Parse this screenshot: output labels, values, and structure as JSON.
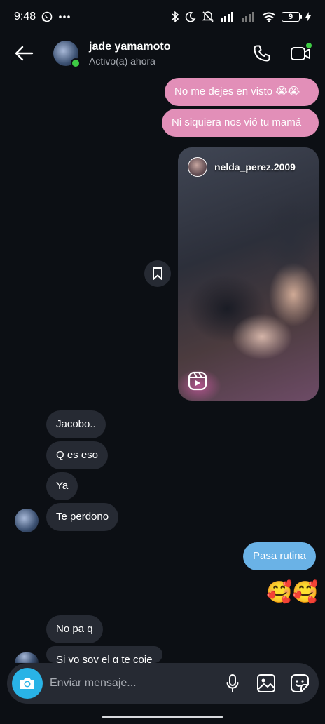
{
  "status_bar": {
    "time": "9:48",
    "battery": "9"
  },
  "header": {
    "name": "jade yamamoto",
    "status": "Activo(a) ahora"
  },
  "messages": {
    "out1": "No me dejes en visto 😭😭",
    "out2": "Ni siquiera nos vió tu mamá",
    "reel_user": "nelda_perez.2009",
    "in1": "Jacobo..",
    "in2": "Q es eso",
    "in3": "Ya",
    "in4": "Te perdono",
    "out3": "Pasa rutina",
    "reaction": "🥰🥰",
    "in5": "No pa q",
    "in6": "Si yo soy el q te coje"
  },
  "composer": {
    "placeholder": "Enviar mensaje..."
  },
  "colors": {
    "background": "#0c0f14",
    "outgoing_pink": "#e28fb8",
    "outgoing_blue": "#6ab2e6",
    "incoming": "#262a33",
    "camera": "#29b3e6",
    "online": "#3ecb44"
  },
  "icons": [
    "whatsapp-icon",
    "more-icon",
    "bluetooth-icon",
    "moon-icon",
    "mute-icon",
    "signal-icon",
    "wifi-icon",
    "battery-icon",
    "charging-icon",
    "back-arrow-icon",
    "phone-icon",
    "video-icon",
    "bookmark-icon",
    "reels-icon",
    "camera-icon",
    "microphone-icon",
    "gallery-icon",
    "sticker-icon"
  ]
}
